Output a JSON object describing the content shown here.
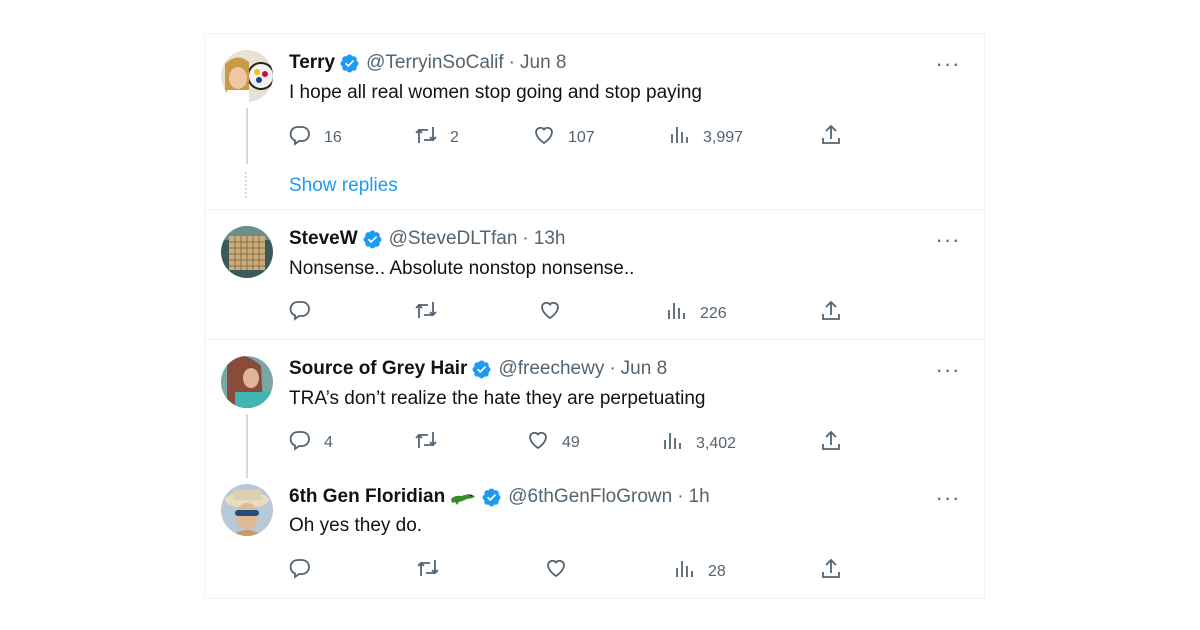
{
  "tweets": [
    {
      "name": "Terry",
      "handle": "@TerryinSoCalif",
      "separator": "·",
      "time": "Jun 8",
      "text": "I hope all real women stop going and stop paying",
      "replies": "16",
      "retweets": "2",
      "likes": "107",
      "views": "3,997"
    },
    {
      "name": "SteveW",
      "handle": "@SteveDLTfan",
      "separator": "·",
      "time": "13h",
      "text": "Nonsense.. Absolute nonstop nonsense..",
      "replies": "",
      "retweets": "",
      "likes": "",
      "views": "226"
    },
    {
      "name": "Source of Grey Hair",
      "handle": "@freechewy",
      "separator": "·",
      "time": "Jun 8",
      "text": "TRA’s don’t realize the hate they are perpetuating",
      "replies": "4",
      "retweets": "",
      "likes": "49",
      "views": "3,402"
    },
    {
      "name": "6th Gen Floridian",
      "handle": "@6thGenFloGrown",
      "separator": "·",
      "time": "1h",
      "text": "Oh yes they do.",
      "replies": "",
      "retweets": "",
      "likes": "",
      "views": "28"
    }
  ],
  "show_replies_label": "Show replies",
  "more_label": "···",
  "colors": {
    "verified": "#1d9bf0",
    "muted": "#536471",
    "link": "#1d9bf0",
    "border": "#eff3f4"
  },
  "icons": [
    "reply-icon",
    "retweet-icon",
    "like-icon",
    "views-icon",
    "share-icon",
    "verified-badge-icon",
    "more-icon",
    "alligator-emoji-icon"
  ]
}
